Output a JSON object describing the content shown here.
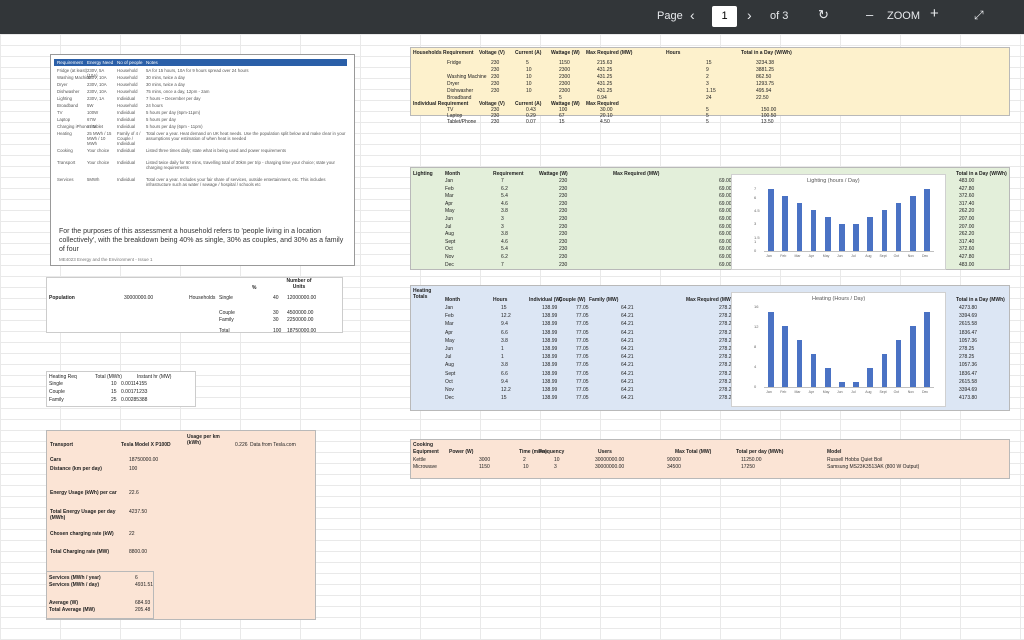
{
  "toolbar": {
    "page_label": "Page",
    "page_number": "1",
    "page_total": "of 3",
    "zoom_label": "ZOOM",
    "prev_icon": "chevron-left-icon",
    "next_icon": "chevron-right-icon",
    "rotate_icon": "rotate-icon",
    "zoom_out_icon": "minus-icon",
    "zoom_in_icon": "plus-icon",
    "fit_icon": "expand-icon"
  },
  "requirements_box": {
    "headers": [
      "Requirement",
      "Energy Need",
      "No of people",
      "Notes"
    ],
    "rows": [
      [
        "Fridge (at least)",
        "230V, 5A (10A)",
        "Household",
        "5A for 15 hours, 10A for 9 hours spread over 24 hours"
      ],
      [
        "Washing Machine",
        "230V, 10A",
        "Household",
        "30 mins, twice a day"
      ],
      [
        "Dryer",
        "230V, 10A",
        "Household",
        "30 mins, twice a day"
      ],
      [
        "Dishwasher",
        "230V, 10A",
        "Household",
        "75 mins, once a day, 12pm - 2am"
      ],
      [
        "Lighting",
        "230V, 1A",
        "Individual",
        "7 hours ~ December per day"
      ],
      [
        "Broadband",
        "5W",
        "Household",
        "24 hours"
      ],
      [
        "TV",
        "100W",
        "Individual",
        "5 hours per day (6pm-11pm)"
      ],
      [
        "Laptop",
        "67W",
        "Individual",
        "5 hours per day"
      ],
      [
        "Charging iPhone / tablet",
        "15W",
        "Individual",
        "5 hours per day (6pm - 11pm)"
      ],
      [
        "Heating",
        "25 MWh / 15 MWh / 10 MWh",
        "Family of 4 / Couple / Individual",
        "Total over a year. Heat demand on UK heat needs. Use the population split below and make clear in your assumptions your estimation of when heat is needed"
      ],
      [
        "Cooking",
        "Your choice",
        "Individual",
        "Listed three times daily; state what is being used and power requirements"
      ],
      [
        "Transport",
        "Your choice",
        "Individual",
        "Listed twice daily for 60 mins, travelling total of 30km per trip - charging time your choice; state your charging requirements"
      ],
      [
        "Services",
        "5MWh",
        "Individual",
        "Total over a year. Includes your fair share of services, outside entertainment, etc. This includes infrastructure such as water / sewage / hospital / schools etc"
      ]
    ],
    "footnote": "For the purposes of this assessment a household refers to 'people living in a location collectively', with the breakdown being 40% as single, 30% as couples, and 30% as a family of four",
    "footer": "ME4023 Energy and the Environment - Issue 1"
  },
  "household": {
    "title": "Households Requirement",
    "headers": [
      "Voltage (V)",
      "Current (A)",
      "Wattage (W)",
      "Max Required (MW)",
      "Hours",
      "Total in a Day (W/Wh)"
    ],
    "rows": [
      [
        "Fridge",
        "230",
        "5",
        "1150",
        "215.63",
        "15",
        "3234.38"
      ],
      [
        "",
        "230",
        "10",
        "2300",
        "431.25",
        "9",
        "3881.25"
      ],
      [
        "Washing Machine",
        "230",
        "10",
        "2300",
        "431.25",
        "2",
        "862.50"
      ],
      [
        "Dryer",
        "230",
        "10",
        "2300",
        "431.25",
        "3",
        "1293.75"
      ],
      [
        "Dishwasher",
        "230",
        "10",
        "2300",
        "431.25",
        "1.15",
        "495.94"
      ],
      [
        "Broadband",
        "",
        "",
        "5",
        "0.94",
        "24",
        "22.50"
      ]
    ]
  },
  "individual": {
    "title": "Individual Requirement",
    "headers": [
      "Voltage (V)",
      "Current (A)",
      "Wattage (W)",
      "Max Required"
    ],
    "rows": [
      [
        "TV",
        "230",
        "0.43",
        "100",
        "30.00",
        "5",
        "150.00"
      ],
      [
        "Laptop",
        "230",
        "0.29",
        "67",
        "20.10",
        "5",
        "100.50"
      ],
      [
        "Tablet/Phone",
        "230",
        "0.07",
        "15",
        "4.50",
        "5",
        "13.50"
      ]
    ]
  },
  "lighting": {
    "title": "Lighting",
    "headers": [
      "Month",
      "Requirement",
      "Wattage (W)",
      "Max Required (MW)",
      "Total in a Day (W/Wh)"
    ],
    "months": [
      "Jan",
      "Feb",
      "Mar",
      "Apr",
      "May",
      "Jun",
      "Jul",
      "Aug",
      "Sept",
      "Oct",
      "Nov",
      "Dec"
    ],
    "hours": [
      "7",
      "6.2",
      "5.4",
      "4.6",
      "3.8",
      "3",
      "3",
      "3.8",
      "4.6",
      "5.4",
      "6.2",
      "7"
    ],
    "watt": "230",
    "max": "69.00",
    "totals": [
      "483.00",
      "427.80",
      "372.60",
      "317.40",
      "262.20",
      "207.00",
      "207.00",
      "262.20",
      "317.40",
      "372.60",
      "427.80",
      "483.00"
    ]
  },
  "population": {
    "label": "Population",
    "value": "30000000.00",
    "household_label": "Households",
    "percent_header": "%",
    "units_header": "Number of Units",
    "rows": [
      [
        "Single",
        "40",
        "12000000.00"
      ],
      [
        "Couple",
        "30",
        "4500000.00"
      ],
      [
        "Family",
        "30",
        "2250000.00"
      ],
      [
        "Total",
        "100",
        "18750000.00"
      ]
    ]
  },
  "heating_split": {
    "headers": [
      "Heating Req",
      "Total (MWh)",
      "Instant hr (MW)"
    ],
    "rows": [
      [
        "Single",
        "10",
        "0.00114155"
      ],
      [
        "Couple",
        "15",
        "0.00171233"
      ],
      [
        "Family",
        "25",
        "0.00285388"
      ]
    ]
  },
  "heating": {
    "title": "Heating Totals",
    "headers": [
      "Month",
      "Hours",
      "Individual (W)",
      "Couple (W)",
      "Family (MW)",
      "Max Required (MW)",
      "Total in a Day (MWh)"
    ],
    "months": [
      "Jan",
      "Feb",
      "Mar",
      "Apr",
      "May",
      "Jun",
      "Jul",
      "Aug",
      "Sept",
      "Oct",
      "Nov",
      "Dec"
    ],
    "hours": [
      "15",
      "12.2",
      "9.4",
      "6.6",
      "3.8",
      "1",
      "1",
      "3.8",
      "6.6",
      "9.4",
      "12.2",
      "15"
    ],
    "individual": "138.99",
    "couple": "77.05",
    "family": "64.21",
    "max": "278.25",
    "totals": [
      "4273.80",
      "3394.69",
      "2615.58",
      "1836.47",
      "1057.36",
      "278.25",
      "278.25",
      "1057.36",
      "1836.47",
      "2615.58",
      "3394.69",
      "4173.80"
    ]
  },
  "lighting_chart": {
    "title": "Lighting (hours / Day)",
    "y_ticks": [
      "0",
      "1",
      "1.5",
      "3",
      "4.5",
      "6",
      "7"
    ],
    "labels": [
      "Jan",
      "Feb",
      "Mar",
      "Apr",
      "May",
      "Jun",
      "Jul",
      "Aug",
      "Sept",
      "Oct",
      "Nov",
      "Dec"
    ]
  },
  "heating_chart": {
    "title": "Heating (Hours / Day)",
    "y_ticks": [
      "0",
      "4",
      "8",
      "12",
      "16"
    ],
    "labels": [
      "Jan",
      "Feb",
      "Mar",
      "Apr",
      "May",
      "Jun",
      "Jul",
      "Aug",
      "Sept",
      "Oct",
      "Nov",
      "Dec"
    ]
  },
  "transport": {
    "title": "Transport",
    "car_model": "Tesla Model X P100D",
    "usage_header": "Usage per km (kWh)",
    "usage_value": "0.226",
    "source": "Data from Tesla.com",
    "rows": [
      [
        "Cars",
        "18750000.00"
      ],
      [
        "Distance (km per day)",
        "100"
      ],
      [
        "Energy Usage (kWh) per car",
        "22.6"
      ],
      [
        "Total Energy Usage per day (MWh)",
        "4237.50"
      ],
      [
        "Chosen charging rate (kW)",
        "22"
      ],
      [
        "Total Charging rate (MW)",
        "8800.00"
      ]
    ]
  },
  "services": {
    "rows": [
      [
        "Services (MWh / year)",
        "6"
      ],
      [
        "Services (MWh / day)",
        "4931.51"
      ],
      [
        "Average (W)",
        "684.93"
      ],
      [
        "Total Average (MW)",
        "205.48"
      ]
    ]
  },
  "cooking": {
    "title": "Cooking",
    "headers": [
      "Equipment",
      "Power (W)",
      "Time (mins)",
      "Frequency",
      "Users",
      "Max Total (MW)",
      "Total per day (MWh)",
      "Model"
    ],
    "rows": [
      [
        "Kettle",
        "3000",
        "2",
        "10",
        "30000000.00",
        "90000",
        "11250.00",
        "Russell Hobbs Quiet Boil"
      ],
      [
        "Microwave",
        "1150",
        "10",
        "3",
        "30000000.00",
        "34500",
        "17250",
        "Samsung MS23K3513AK (800 W Output)"
      ]
    ]
  },
  "chart_data": [
    {
      "type": "bar",
      "title": "Lighting (hours / Day)",
      "categories": [
        "Jan",
        "Feb",
        "Mar",
        "Apr",
        "May",
        "Jun",
        "Jul",
        "Aug",
        "Sept",
        "Oct",
        "Nov",
        "Dec"
      ],
      "values": [
        7,
        6.2,
        5.4,
        4.6,
        3.8,
        3,
        3,
        3.8,
        4.6,
        5.4,
        6.2,
        7
      ],
      "ylim": [
        0,
        7
      ],
      "xlabel": "",
      "ylabel": ""
    },
    {
      "type": "bar",
      "title": "Heating (Hours / Day)",
      "categories": [
        "Jan",
        "Feb",
        "Mar",
        "Apr",
        "May",
        "Jun",
        "Jul",
        "Aug",
        "Sept",
        "Oct",
        "Nov",
        "Dec"
      ],
      "values": [
        15,
        12.2,
        9.4,
        6.6,
        3.8,
        1,
        1,
        3.8,
        6.6,
        9.4,
        12.2,
        15
      ],
      "ylim": [
        0,
        16
      ],
      "xlabel": "",
      "ylabel": ""
    }
  ],
  "colors": {
    "toolbar": "#323639",
    "household_fill": "#fdf1cc",
    "lighting_fill": "#e3efda",
    "heating_fill": "#dce6f4",
    "orange_fill": "#fbe4d5",
    "bar": "#4a72c4",
    "header_blue": "#1f4e9c"
  }
}
